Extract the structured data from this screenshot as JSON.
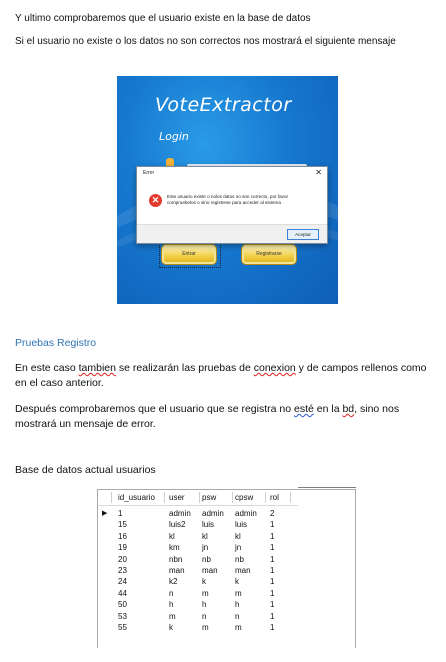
{
  "intro": {
    "line1": "Y ultimo comprobaremos que el usuario existe en la base de datos",
    "line2": "Si el usuario no existe o los datos no son correctos nos mostrará el siguiente mensaje"
  },
  "app": {
    "title": "VoteExtractor",
    "login_label": "Login",
    "enter_button": "Entrar",
    "register_button": "Registrarse"
  },
  "dialog": {
    "title": "Error",
    "close_glyph": "✕",
    "message": "Este usuario existe o nolos datos no son correcto, por favor compruebelos o sino registrese para acceder al sistema",
    "ok_button": "Aceptar",
    "icon": "error-x-icon"
  },
  "section": {
    "heading": "Pruebas Registro",
    "para1_a": "En este caso ",
    "para1_w1": "tambien",
    "para1_b": " se realizarán las pruebas de ",
    "para1_w2": "conexion",
    "para1_c": " y de campos rellenos como en el caso anterior.",
    "para2_a": "Después comprobaremos que el usuario que se registra no ",
    "para2_w1": "esté",
    "para2_b": " en la ",
    "para2_w2": "bd",
    "para2_c": ", sino nos mostrará un mensaje de error.",
    "db_caption": "Base de datos actual usuarios"
  },
  "table": {
    "columns": [
      "id_usuario",
      "user",
      "psw",
      "cpsw",
      "rol"
    ],
    "rows": [
      [
        "1",
        "admin",
        "admin",
        "admin",
        "2"
      ],
      [
        "15",
        "luis2",
        "luis",
        "luis",
        "1"
      ],
      [
        "16",
        "kl",
        "kl",
        "kl",
        "1"
      ],
      [
        "19",
        "km",
        "jn",
        "jn",
        "1"
      ],
      [
        "20",
        "nbn",
        "nb",
        "nb",
        "1"
      ],
      [
        "23",
        "man",
        "man",
        "man",
        "1"
      ],
      [
        "24",
        "k2",
        "k",
        "k",
        "1"
      ],
      [
        "44",
        "n",
        "m",
        "m",
        "1"
      ],
      [
        "50",
        "h",
        "h",
        "h",
        "1"
      ],
      [
        "53",
        "m",
        "n",
        "n",
        "1"
      ],
      [
        "55",
        "k",
        "m",
        "m",
        "1"
      ]
    ],
    "current_row_marker": "▶"
  }
}
